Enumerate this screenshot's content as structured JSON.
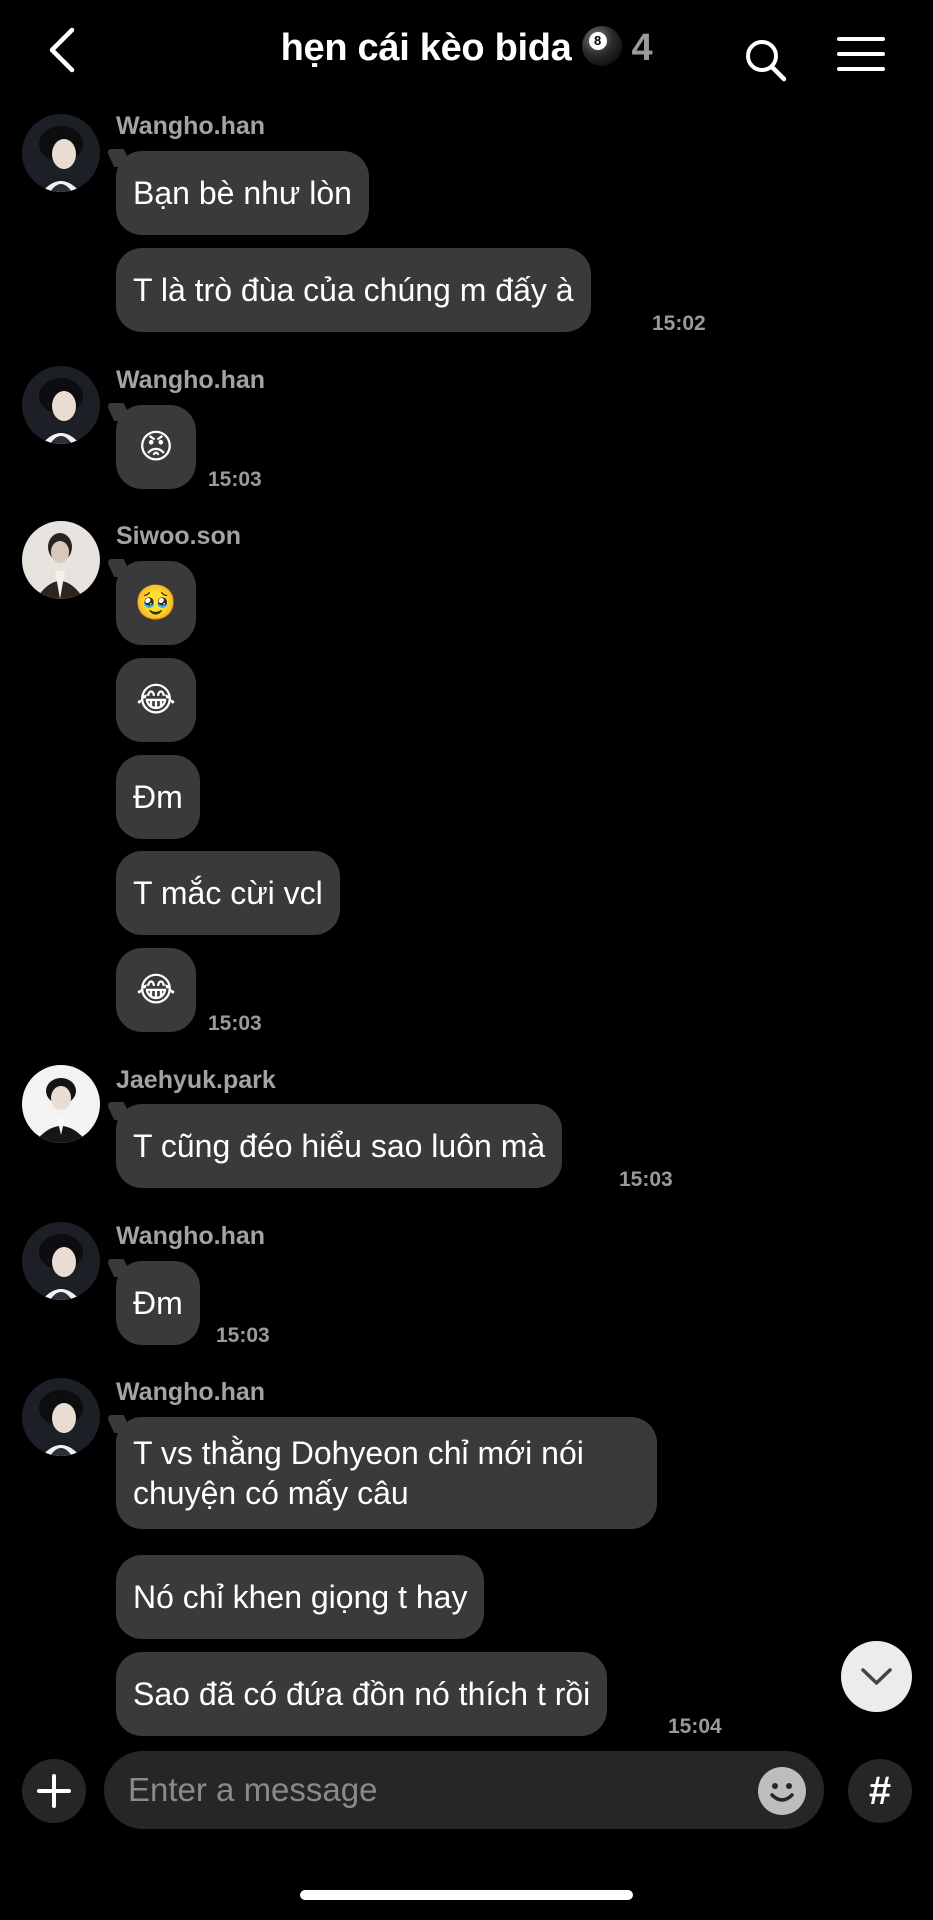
{
  "header": {
    "title": "hẹn cái kèo bida",
    "member_count": "4",
    "back_icon": "chevron-left-icon",
    "search_icon": "search-icon",
    "menu_icon": "hamburger-menu-icon"
  },
  "messages": [
    {
      "sender": "Wangho.han",
      "bubbles": [
        "Bạn bè như lòn",
        "T là trò đùa của chúng m đấy à"
      ],
      "time": "15:02"
    },
    {
      "sender": "Wangho.han",
      "bubbles": [
        "😡"
      ],
      "time": "15:03"
    },
    {
      "sender": "Siwoo.son",
      "bubbles": [
        "🥹",
        "😂",
        "Đm",
        "T mắc cừi vcl",
        "😂"
      ],
      "time": "15:03"
    },
    {
      "sender": "Jaehyuk.park",
      "bubbles": [
        "T cũng đéo hiểu sao luôn mà"
      ],
      "time": "15:03"
    },
    {
      "sender": "Wangho.han",
      "bubbles": [
        "Đm"
      ],
      "time": "15:03"
    },
    {
      "sender": "Wangho.han",
      "bubbles": [
        "T vs thằng Dohyeon chỉ mới nói chuyện có mấy câu",
        "Nó chỉ khen giọng t hay",
        "Sao đã có đứa đồn nó thích t rồi"
      ],
      "time": "15:04"
    }
  ],
  "composer": {
    "placeholder": "Enter a message",
    "plus_icon": "plus-icon",
    "emoji_icon": "emoji-icon",
    "hash_label": "#"
  },
  "scroll_down_icon": "chevron-down-icon"
}
